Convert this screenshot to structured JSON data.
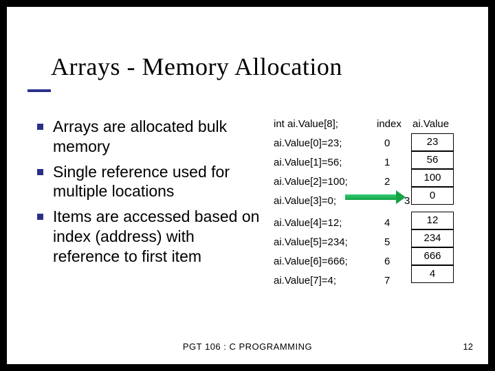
{
  "title": "Arrays - Memory Allocation",
  "bullets": [
    "Arrays are allocated bulk memory",
    "Single reference used for multiple locations",
    "Items are accessed based on index (address) with reference to first item"
  ],
  "code": {
    "declaration": "int ai.Value[8];",
    "header_index": "index",
    "header_value": "ai.Value",
    "rows": [
      {
        "code": "ai.Value[0]=23;",
        "index": "0",
        "value": "23"
      },
      {
        "code": "ai.Value[1]=56;",
        "index": "1",
        "value": "56"
      },
      {
        "code": "ai.Value[2]=100;",
        "index": "2",
        "value": "100"
      },
      {
        "code": "ai.Value[3]=0;",
        "index": "3",
        "value": "0"
      },
      {
        "code": "ai.Value[4]=12;",
        "index": "4",
        "value": "12"
      },
      {
        "code": "ai.Value[5]=234;",
        "index": "5",
        "value": "234"
      },
      {
        "code": "ai.Value[6]=666;",
        "index": "6",
        "value": "666"
      },
      {
        "code": "ai.Value[7]=4;",
        "index": "7",
        "value": "4"
      }
    ],
    "arrow_row": 3
  },
  "footer": "PGT 106 : C PROGRAMMING",
  "page_number": "12"
}
